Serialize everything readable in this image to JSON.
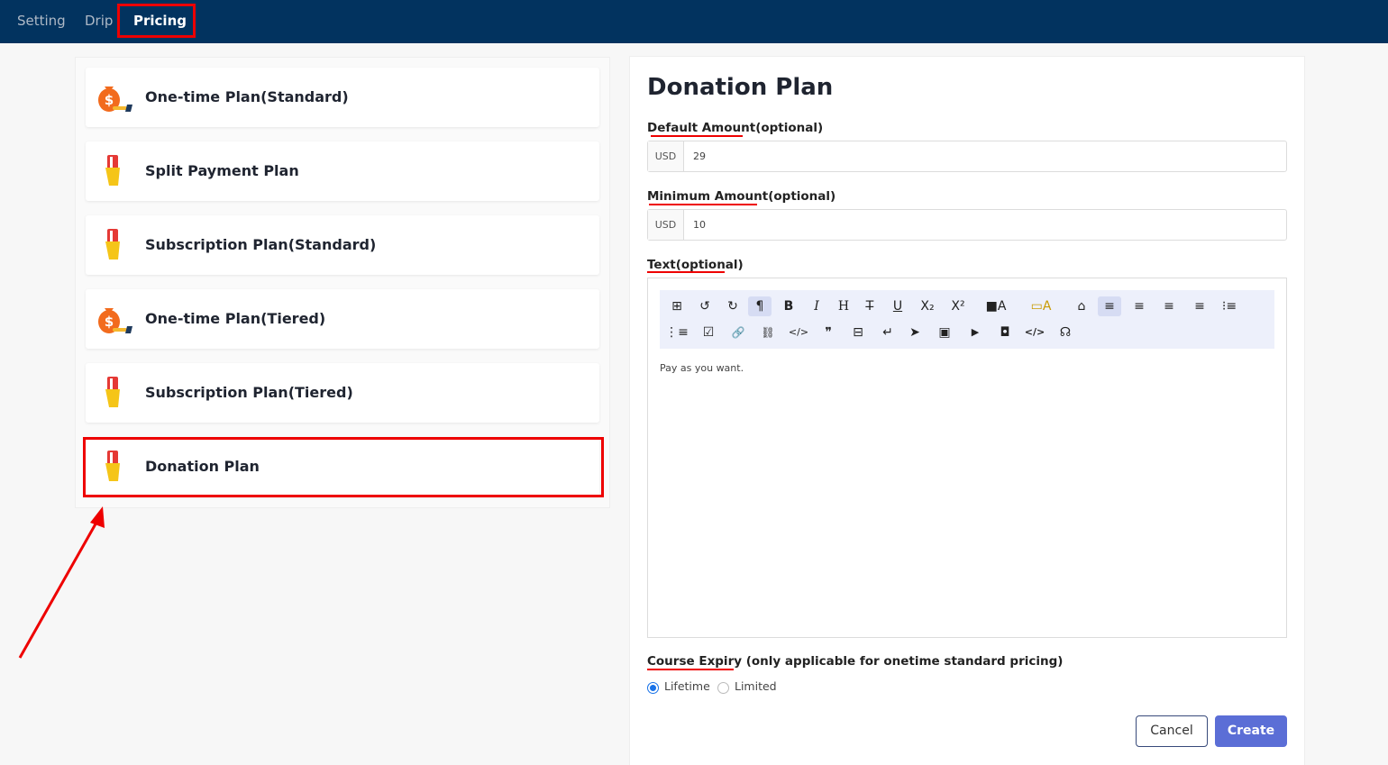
{
  "nav": {
    "tabs": [
      {
        "label": "Setting"
      },
      {
        "label": "Drip"
      },
      {
        "label": "Pricing"
      }
    ],
    "active_tab": "Pricing"
  },
  "plans": [
    {
      "label": "One-time Plan(Standard)",
      "icon": "money-bag-icon"
    },
    {
      "label": "Split Payment Plan",
      "icon": "card-hand-icon"
    },
    {
      "label": "Subscription Plan(Standard)",
      "icon": "card-hand-icon"
    },
    {
      "label": "One-time Plan(Tiered)",
      "icon": "money-bag-icon"
    },
    {
      "label": "Subscription Plan(Tiered)",
      "icon": "card-hand-icon"
    },
    {
      "label": "Donation Plan",
      "icon": "card-hand-icon"
    }
  ],
  "selected_plan": "Donation Plan",
  "form": {
    "title": "Donation Plan",
    "default_amount": {
      "label_main": "Default Amount",
      "label_suffix": "(optional)",
      "currency": "USD",
      "value": "29"
    },
    "minimum_amount": {
      "label_main": "Minimum Amount",
      "label_suffix": "(optional)",
      "currency": "USD",
      "value": "10"
    },
    "text": {
      "label_main": "Text",
      "label_suffix": "(optional)",
      "content": "Pay as you want."
    },
    "course_expiry": {
      "label_main": "Course Expiry",
      "label_suffix": " (only applicable for onetime standard pricing)",
      "options": [
        {
          "label": "Lifetime",
          "checked": true
        },
        {
          "label": "Limited",
          "checked": false
        }
      ]
    },
    "cancel_label": "Cancel",
    "create_label": "Create"
  },
  "toolbar": {
    "row1": [
      "⊞",
      "↺",
      "↻",
      "¶",
      "B",
      "I",
      "H",
      "T̶",
      "U",
      "X₂",
      "X²",
      "■A",
      "▭A",
      "⌂",
      "≡",
      "≡",
      "≡",
      "≡",
      "⁝≡"
    ],
    "row2": [
      "⋮≡",
      "☑",
      "🔗",
      "⛓",
      "</>",
      "❞",
      "⊟",
      "↵",
      "➤",
      "▣",
      "▶",
      "◘",
      "</>",
      "☊"
    ]
  },
  "colors": {
    "nav_bg": "#02335f",
    "highlight": "#ee0000",
    "primary": "#5b6ed6",
    "toolbar_bg": "#edf0fb"
  }
}
